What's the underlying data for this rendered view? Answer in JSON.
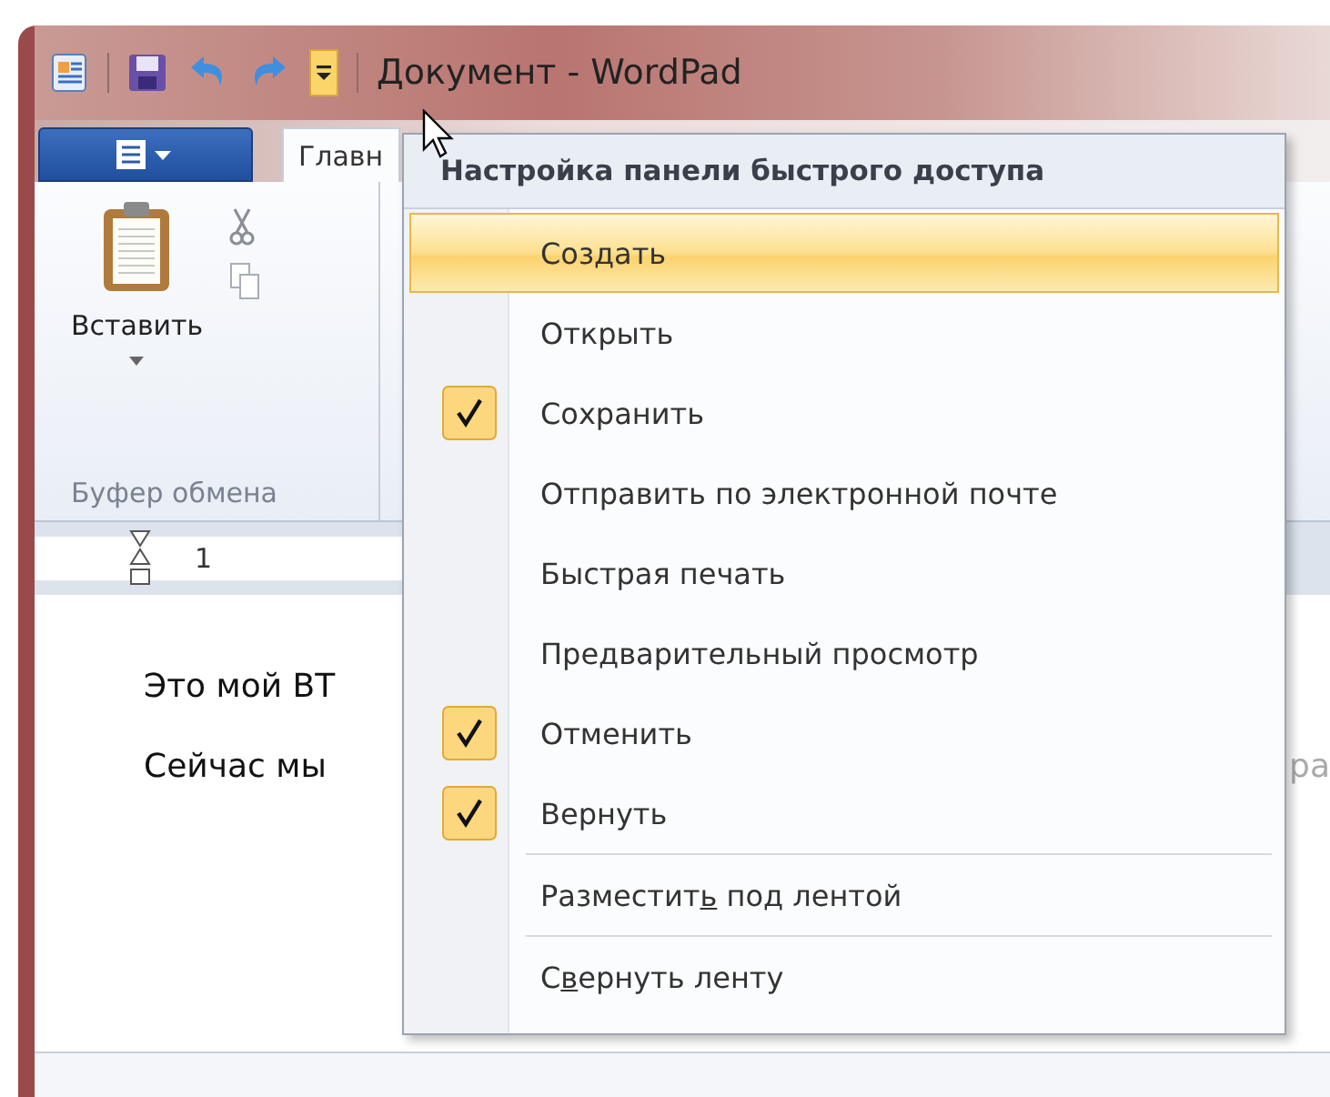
{
  "window": {
    "title": "Документ - WordPad"
  },
  "quick_access_toolbar": {
    "customize_pressed": true
  },
  "ribbon": {
    "tabs": [
      {
        "label": "Главн",
        "selected": true
      }
    ],
    "groups": [
      {
        "label": "Буфер обмена",
        "paste_label": "Вставить"
      }
    ]
  },
  "ruler": {
    "label": "1"
  },
  "document": {
    "lines": [
      {
        "text": "Это мой ВТ"
      },
      {
        "text": "Сейчас мы",
        "tail": "ра"
      }
    ]
  },
  "menu": {
    "title": "Настройка панели быстрого доступа",
    "items": [
      {
        "kind": "item",
        "label": "Создать",
        "checked": false,
        "selected": true
      },
      {
        "kind": "item",
        "label": "Открыть",
        "checked": false,
        "selected": false
      },
      {
        "kind": "item",
        "label": "Сохранить",
        "checked": true,
        "selected": false
      },
      {
        "kind": "item",
        "label": "Отправить по электронной почте",
        "checked": false,
        "selected": false
      },
      {
        "kind": "item",
        "label": "Быстрая печать",
        "checked": false,
        "selected": false
      },
      {
        "kind": "item",
        "label": "Предварительный просмотр",
        "checked": false,
        "selected": false
      },
      {
        "kind": "item",
        "label": "Отменить",
        "checked": true,
        "selected": false
      },
      {
        "kind": "item",
        "label": "Вернуть",
        "checked": true,
        "selected": false
      },
      {
        "kind": "separator"
      },
      {
        "kind": "item",
        "label": "Разместит",
        "access_key": "ь",
        "label_after": " под лентой",
        "checked": false,
        "selected": false
      },
      {
        "kind": "separator"
      },
      {
        "kind": "item",
        "label": "С",
        "access_key": "в",
        "label_after": "ернуть ленту",
        "checked": false,
        "selected": false
      }
    ]
  }
}
